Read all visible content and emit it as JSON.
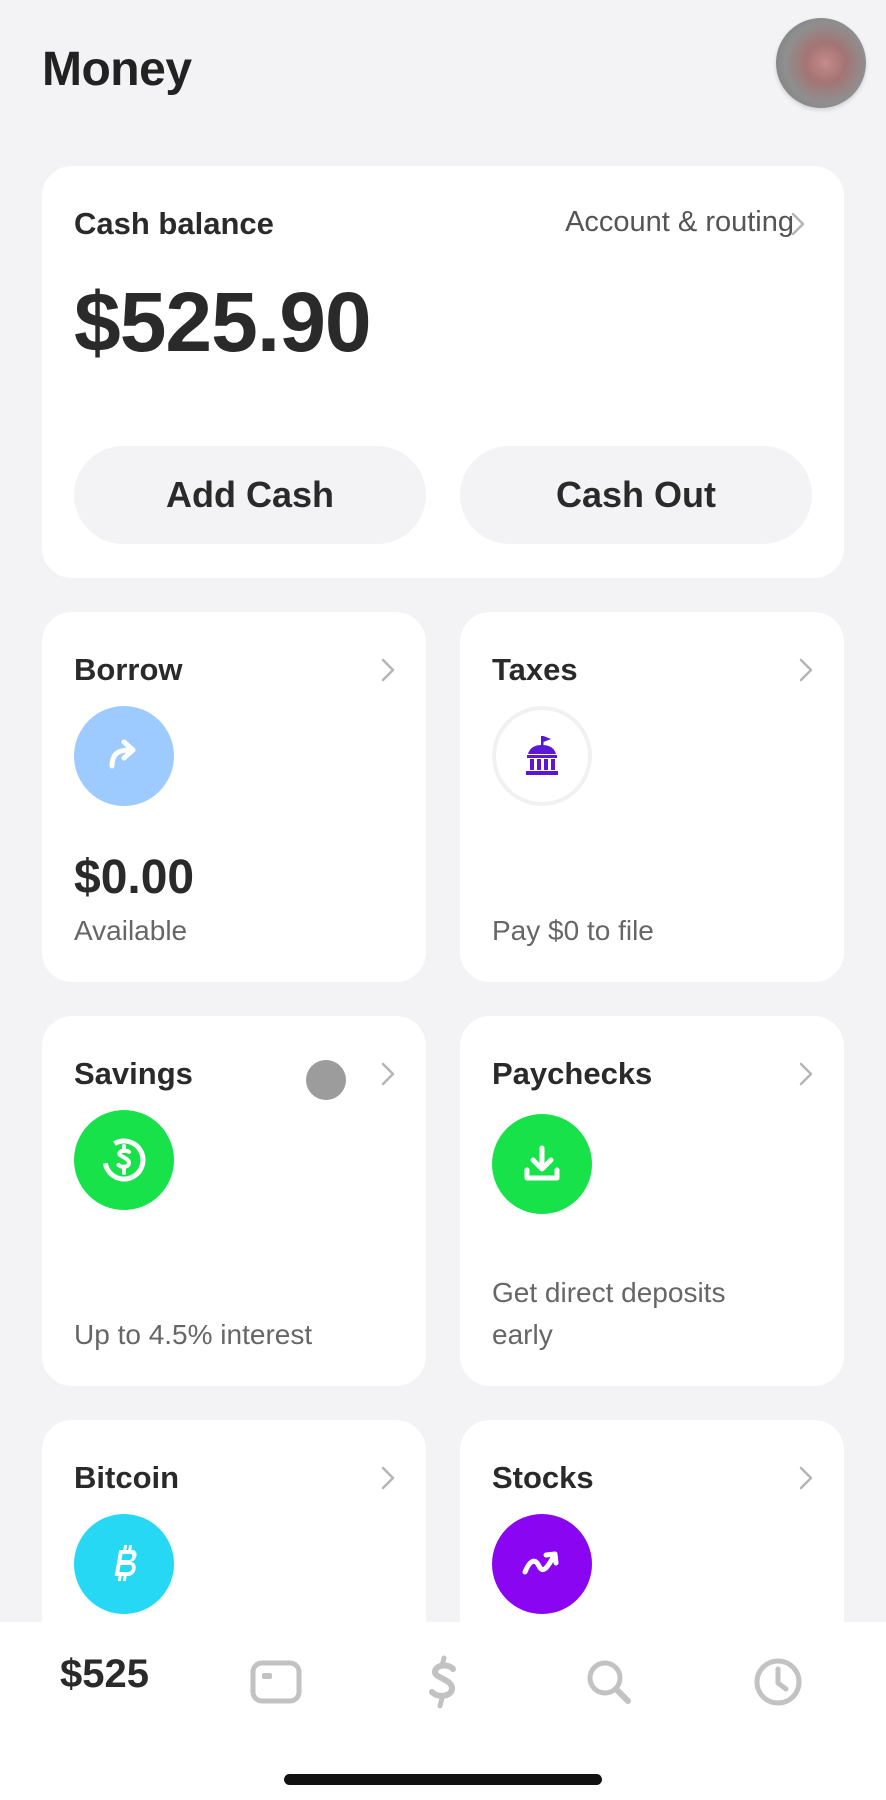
{
  "header": {
    "title": "Money"
  },
  "cash": {
    "label": "Cash balance",
    "account_link": "Account & routing",
    "balance": "$525.90",
    "add_cash": "Add Cash",
    "cash_out": "Cash Out"
  },
  "tiles": {
    "borrow": {
      "title": "Borrow",
      "value": "$0.00",
      "sub": "Available",
      "color": "#9ecbff",
      "icon": "arrow-turn-right-icon"
    },
    "taxes": {
      "title": "Taxes",
      "sub": "Pay $0 to file",
      "color": "#5b16d8",
      "icon": "government-building-icon"
    },
    "savings": {
      "title": "Savings",
      "sub": "Up to 4.5% interest",
      "color": "#18e24a",
      "icon": "dollar-circle-icon"
    },
    "paychecks": {
      "title": "Paychecks",
      "sub_line1": "Get direct deposits",
      "sub_line2": "early",
      "color": "#18e24a",
      "icon": "download-tray-icon"
    },
    "bitcoin": {
      "title": "Bitcoin",
      "color": "#27d8f5",
      "icon": "bitcoin-icon"
    },
    "stocks": {
      "title": "Stocks",
      "color": "#8a06f2",
      "icon": "trend-up-icon"
    }
  },
  "tabbar": {
    "money_label": "$525",
    "icons": [
      "card-icon",
      "dollar-icon",
      "search-icon",
      "clock-icon"
    ]
  }
}
